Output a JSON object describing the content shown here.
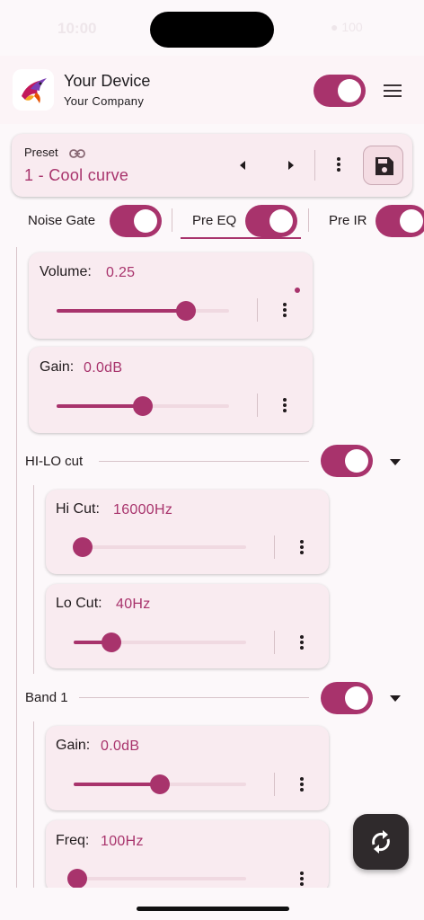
{
  "status": {
    "time": "10:00",
    "right": "● 100"
  },
  "header": {
    "device_name": "Your Device",
    "company_name": "Your Company"
  },
  "preset": {
    "label": "Preset",
    "name": "1 - Cool curve"
  },
  "tabs": [
    {
      "label": "Noise Gate",
      "enabled": true
    },
    {
      "label": "Pre EQ",
      "enabled": true,
      "selected": true
    },
    {
      "label": "Pre IR",
      "enabled": true
    }
  ],
  "controls": {
    "volume": {
      "label": "Volume:",
      "value": "0.25",
      "fraction": 0.75
    },
    "gain": {
      "label": "Gain:",
      "value": "0.0dB",
      "fraction": 0.5
    },
    "hi_cut": {
      "label": "Hi Cut:",
      "value": "16000Hz",
      "fraction": 0.05
    },
    "lo_cut": {
      "label": "Lo Cut:",
      "value": "40Hz",
      "fraction": 0.22
    },
    "band1_gain": {
      "label": "Gain:",
      "value": "0.0dB",
      "fraction": 0.5
    },
    "band1_freq": {
      "label": "Freq:",
      "value": "100Hz",
      "fraction": 0.02
    }
  },
  "sections": {
    "hi_lo": {
      "label": "HI-LO cut",
      "enabled": true
    },
    "band1": {
      "label": "Band 1",
      "enabled": true
    }
  },
  "icons": {
    "logo": "bird-logo-icon",
    "menu": "hamburger-menu-icon",
    "link": "link-icon",
    "prev": "caret-left-icon",
    "next": "caret-right-icon",
    "more": "more-vertical-icon",
    "save": "floppy-disk-icon",
    "expand": "caret-down-icon",
    "sync": "sync-icon"
  },
  "colors": {
    "accent": "#a8336c",
    "card": "#f9ebf0",
    "background": "#fcf8fa"
  }
}
